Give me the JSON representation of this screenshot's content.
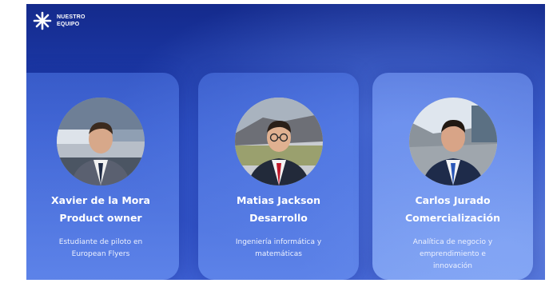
{
  "brand": {
    "line1": "NUESTRO",
    "line2": "EQUIPO",
    "icon": "asterisk-icon"
  },
  "members": [
    {
      "name": "Xavier de la Mora",
      "role": "Product owner",
      "desc_line1": "Estudiante de piloto en",
      "desc_line2": "European Flyers",
      "desc_line3": ""
    },
    {
      "name": "Matias Jackson",
      "role": "Desarrollo",
      "desc_line1": "Ingeniería informática y",
      "desc_line2": "matemáticas",
      "desc_line3": ""
    },
    {
      "name": "Carlos Jurado",
      "role": "Comercialización",
      "desc_line1": "Analítica de negocio y",
      "desc_line2": "emprendimiento e",
      "desc_line3": "innovación"
    }
  ],
  "colors": {
    "background": "#2142b8",
    "card": "#5d83e6",
    "text": "#ffffff"
  }
}
